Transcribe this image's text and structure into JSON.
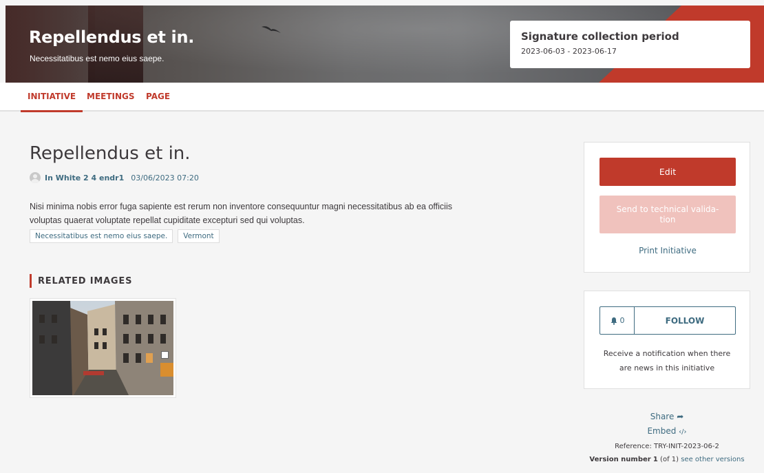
{
  "hero": {
    "title": "Repellendus et in.",
    "subtitle": "Necessitatibus est nemo eius saepe.",
    "signature_label": "Signature collection period",
    "signature_dates": "2023-06-03 - 2023-06-17"
  },
  "tabs": [
    {
      "label": "INITIATIVE",
      "active": true
    },
    {
      "label": "MEETINGS",
      "active": false
    },
    {
      "label": "PAGE",
      "active": false
    }
  ],
  "main": {
    "title": "Repellendus et in.",
    "author": "In White 2 4 endr1",
    "date": "03/06/2023 07:20",
    "body_line1": "Nisi minima nobis error fuga sapiente est rerum non inventore consequuntur magni necessitatibus ab ea officiis",
    "body_line2": "voluptas quaerat voluptate repellat cupiditate excepturi sed qui voluptas.",
    "tags": [
      "Necessitatibus est nemo eius saepe.",
      "Vermont"
    ],
    "related_title": "RELATED IMAGES"
  },
  "sidebar": {
    "edit_label": "Edit",
    "send_label": "Send to technical valida-tion",
    "print_label": "Print Initiative",
    "follow_count": "0",
    "follow_label": "FOLLOW",
    "follow_note": "Receive a notification when there are news in this initiative",
    "share_label": "Share",
    "embed_label": "Embed",
    "reference": "Reference: TRY-INIT-2023-06-2",
    "version_prefix": "Version number",
    "version_number": "1",
    "version_of": "(of 1)",
    "version_link": "see other versions"
  },
  "colors": {
    "accent": "#c03a2b",
    "link": "#3e6b80"
  }
}
